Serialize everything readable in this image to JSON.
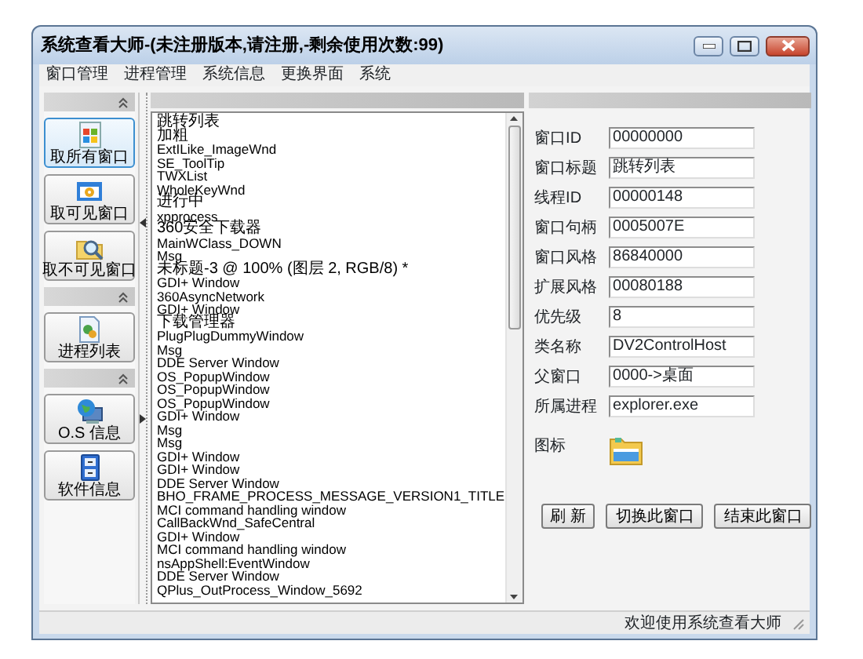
{
  "window": {
    "title": "系统查看大师-(未注册版本,请注册,-剩余使用次数:99)"
  },
  "menu": [
    "窗口管理",
    "进程管理",
    "系统信息",
    "更换界面",
    "系统"
  ],
  "sidebar": {
    "groups": [
      {
        "buttons": [
          {
            "label": "取所有窗口",
            "kind": "windows",
            "selected": true
          },
          {
            "label": "取可见窗口",
            "kind": "gear",
            "selected": false
          },
          {
            "label": "取不可见窗口",
            "kind": "magnifier",
            "selected": false
          }
        ]
      },
      {
        "buttons": [
          {
            "label": "进程列表",
            "kind": "process",
            "selected": false
          }
        ]
      },
      {
        "buttons": [
          {
            "label": "O.S 信息",
            "kind": "globe",
            "selected": false
          },
          {
            "label": "软件信息",
            "kind": "cabinet",
            "selected": false
          }
        ]
      }
    ]
  },
  "window_list": {
    "items": [
      "跳转列表",
      "加粗",
      "ExtILike_ImageWnd",
      "SE_ToolTip",
      "TWXList",
      "WholeKeyWnd",
      "进行中",
      "xpprocess",
      "360安全下载器",
      "MainWClass_DOWN",
      "Msg",
      "未标题-3 @ 100% (图层 2, RGB/8) *",
      "GDI+ Window",
      "360AsyncNetwork",
      "GDI+ Window",
      "下载管理器",
      "PlugPlugDummyWindow",
      "Msg",
      "DDE Server Window",
      "OS_PopupWindow",
      "OS_PopupWindow",
      "OS_PopupWindow",
      "GDI+ Window",
      "Msg",
      "Msg",
      "GDI+ Window",
      "GDI+ Window",
      "DDE Server Window",
      "BHO_FRAME_PROCESS_MESSAGE_VERSION1_TITLE",
      "MCI command handling window",
      "CallBackWnd_SafeCentral",
      "GDI+ Window",
      "MCI command handling window",
      "nsAppShell:EventWindow",
      "DDE Server Window",
      "QPlus_OutProcess_Window_5692"
    ]
  },
  "details": {
    "fields": [
      {
        "label": "窗口ID",
        "value": "00000000"
      },
      {
        "label": "窗口标题",
        "value": "跳转列表"
      },
      {
        "label": "线程ID",
        "value": "00000148"
      },
      {
        "label": "窗口句柄",
        "value": "0005007E"
      },
      {
        "label": "窗口风格",
        "value": "86840000"
      },
      {
        "label": "扩展风格",
        "value": "00080188"
      },
      {
        "label": "优先级",
        "value": "8"
      },
      {
        "label": "类名称",
        "value": "DV2ControlHost"
      },
      {
        "label": "父窗口",
        "value": "0000->桌面"
      },
      {
        "label": "所属进程",
        "value": "explorer.exe"
      }
    ],
    "icon_label": "图标",
    "buttons": [
      "刷 新",
      "切换此窗口",
      "结束此窗口"
    ]
  },
  "status_bar": "欢迎使用系统查看大师"
}
